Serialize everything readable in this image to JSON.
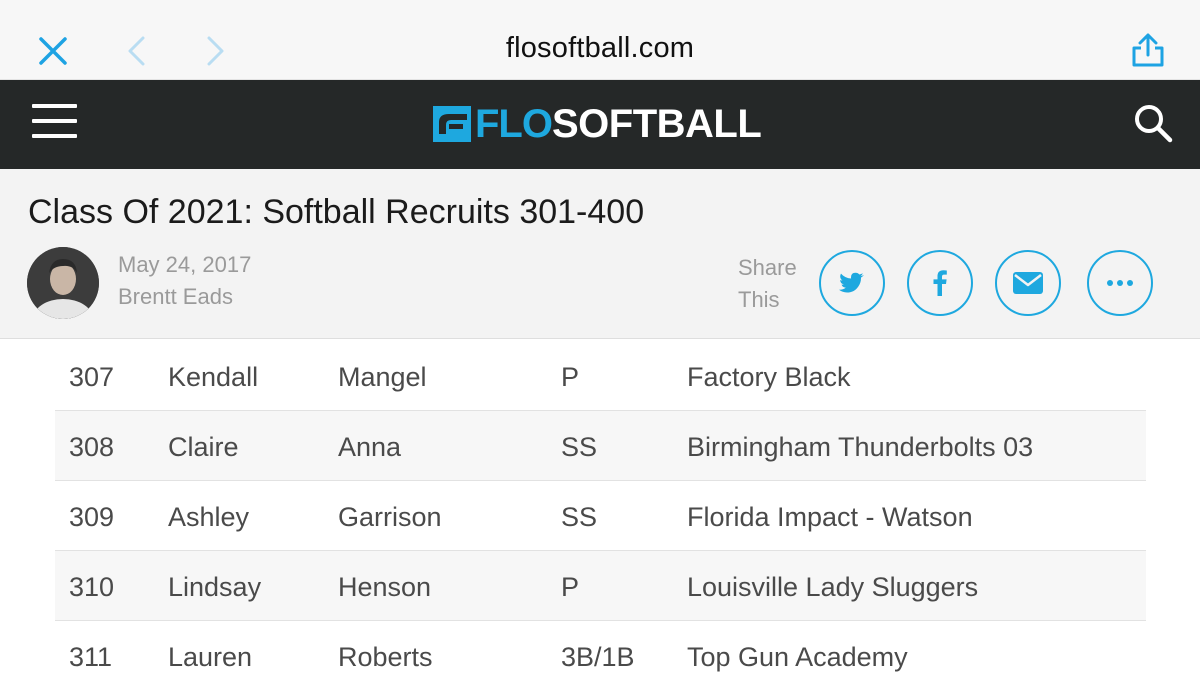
{
  "browser": {
    "url": "flosoftball.com",
    "icons": [
      "close-icon",
      "back-icon",
      "forward-icon",
      "share-icon"
    ]
  },
  "site": {
    "logo_flo": "FLO",
    "logo_sport": "SOFTBALL",
    "brand_color": "#1ea8df",
    "header_color": "#252828"
  },
  "article": {
    "title": "Class Of 2021: Softball Recruits 301-400",
    "date": "May 24, 2017",
    "author": "Brentt Eads",
    "share_label": "Share This",
    "share_buttons": [
      "twitter-icon",
      "facebook-icon",
      "email-icon",
      "more-icon"
    ]
  },
  "recruits": [
    {
      "rank": "307",
      "first": "Kendall",
      "last": "Mangel",
      "pos": "P",
      "team": "Factory Black"
    },
    {
      "rank": "308",
      "first": "Claire",
      "last": "Anna",
      "pos": "SS",
      "team": "Birmingham Thunderbolts 03"
    },
    {
      "rank": "309",
      "first": "Ashley",
      "last": "Garrison",
      "pos": "SS",
      "team": "Florida Impact - Watson"
    },
    {
      "rank": "310",
      "first": "Lindsay",
      "last": "Henson",
      "pos": "P",
      "team": "Louisville Lady Sluggers"
    },
    {
      "rank": "311",
      "first": "Lauren",
      "last": "Roberts",
      "pos": "3B/1B",
      "team": "Top Gun Academy"
    }
  ]
}
